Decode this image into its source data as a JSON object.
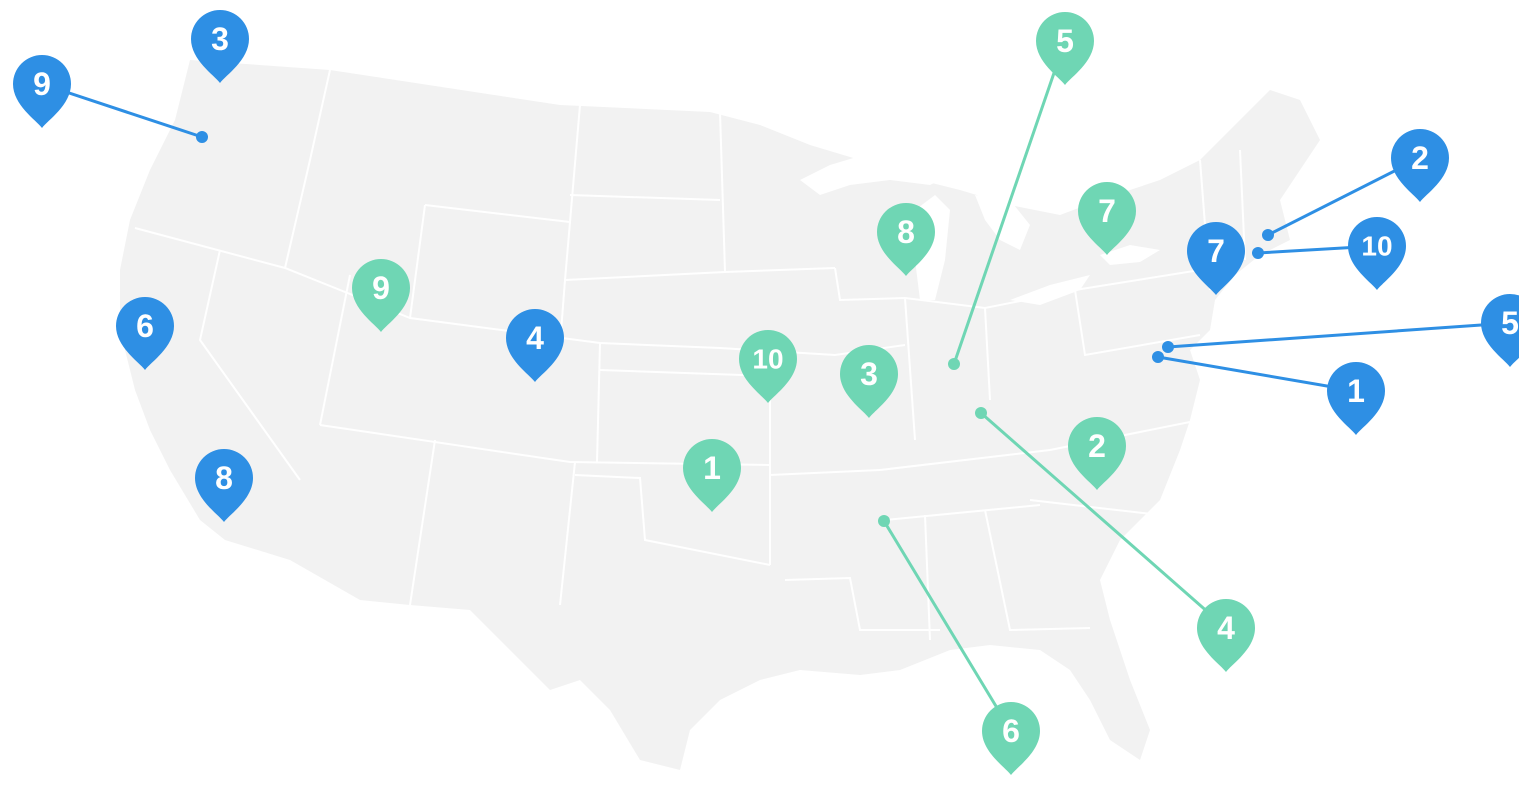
{
  "map": {
    "land_color": "#f2f2f2",
    "border_color": "#ffffff",
    "blue": "#2e8fe4",
    "green": "#6fd6b4",
    "pins": [
      {
        "id": "b9",
        "label": "9",
        "color": "blue"
      },
      {
        "id": "b3",
        "label": "3",
        "color": "blue"
      },
      {
        "id": "b6",
        "label": "6",
        "color": "blue"
      },
      {
        "id": "b8",
        "label": "8",
        "color": "blue"
      },
      {
        "id": "b4",
        "label": "4",
        "color": "blue"
      },
      {
        "id": "b2",
        "label": "2",
        "color": "blue"
      },
      {
        "id": "b7",
        "label": "7",
        "color": "blue"
      },
      {
        "id": "b10",
        "label": "10",
        "color": "blue"
      },
      {
        "id": "b5",
        "label": "5",
        "color": "blue"
      },
      {
        "id": "b1",
        "label": "1",
        "color": "blue"
      },
      {
        "id": "g5",
        "label": "5",
        "color": "green"
      },
      {
        "id": "g8",
        "label": "8",
        "color": "green"
      },
      {
        "id": "g7",
        "label": "7",
        "color": "green"
      },
      {
        "id": "g9",
        "label": "9",
        "color": "green"
      },
      {
        "id": "g10",
        "label": "10",
        "color": "green"
      },
      {
        "id": "g3",
        "label": "3",
        "color": "green"
      },
      {
        "id": "g2",
        "label": "2",
        "color": "green"
      },
      {
        "id": "g1",
        "label": "1",
        "color": "green"
      },
      {
        "id": "g4",
        "label": "4",
        "color": "green"
      },
      {
        "id": "g6",
        "label": "6",
        "color": "green"
      }
    ]
  }
}
